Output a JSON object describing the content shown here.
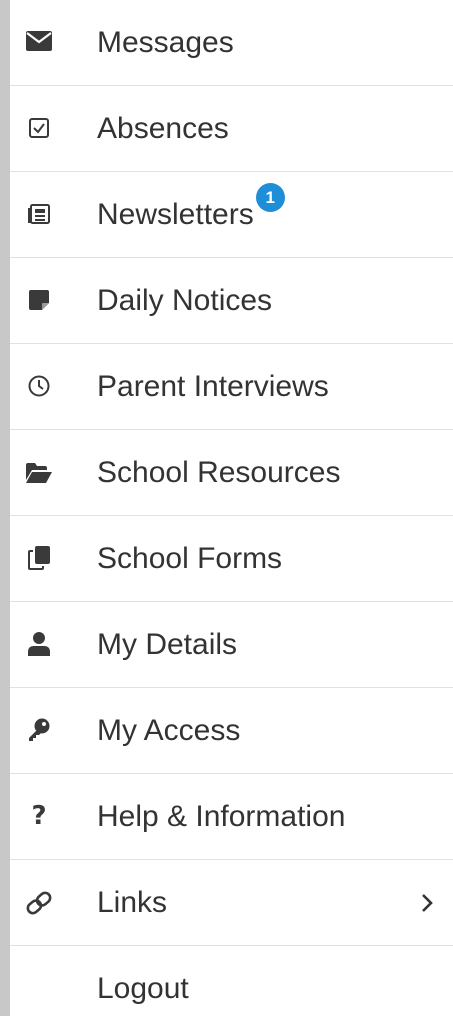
{
  "menu": {
    "items": [
      {
        "label": "Messages",
        "icon": "envelope-icon"
      },
      {
        "label": "Absences",
        "icon": "checkbox-icon"
      },
      {
        "label": "Newsletters",
        "icon": "newspaper-icon",
        "badge": "1"
      },
      {
        "label": "Daily Notices",
        "icon": "sticky-note-icon"
      },
      {
        "label": "Parent Interviews",
        "icon": "clock-icon"
      },
      {
        "label": "School Resources",
        "icon": "folder-open-icon"
      },
      {
        "label": "School Forms",
        "icon": "copy-icon"
      },
      {
        "label": "My Details",
        "icon": "user-icon"
      },
      {
        "label": "My Access",
        "icon": "key-icon"
      },
      {
        "label": "Help & Information",
        "icon": "question-icon"
      },
      {
        "label": "Links",
        "icon": "link-icon",
        "submenu_icon": "chevron-right-icon"
      },
      {
        "label": "Logout"
      }
    ]
  },
  "colors": {
    "background": "#c8c8c8",
    "panel": "#ffffff",
    "text": "#333333",
    "divider": "#e2e2e2",
    "badge": "#1e8fd6"
  }
}
